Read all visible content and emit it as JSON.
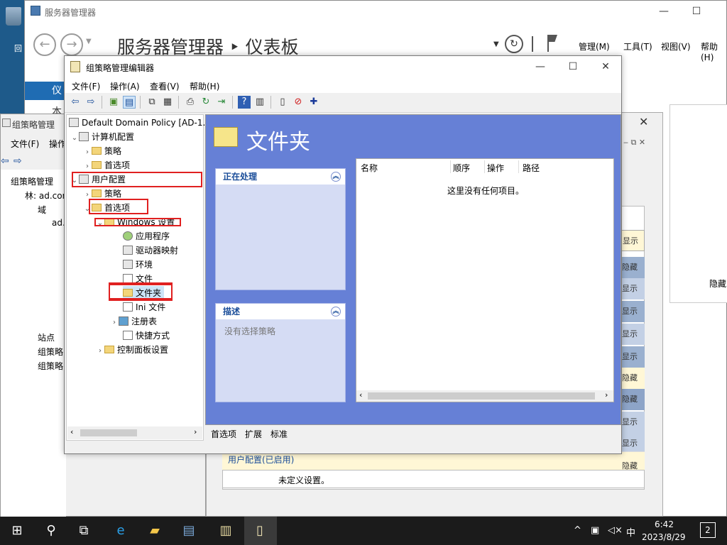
{
  "desktop": {
    "icon_label": "回"
  },
  "server_manager": {
    "title": "服务器管理器",
    "breadcrumb": "服务器管理器 ‣ 仪表板",
    "menus": [
      "管理(M)",
      "工具(T)",
      "视图(V)",
      "帮助(H)"
    ],
    "sidebar_selected": "仪",
    "sidebar_item": "本",
    "hide_label": "隐藏"
  },
  "gpm": {
    "title": "组策略管理",
    "menus": [
      "文件(F)",
      "操作"
    ],
    "tree": [
      {
        "label": "组策略管理"
      },
      {
        "label": "林: ad.com"
      },
      {
        "label": "域"
      },
      {
        "label": "ad."
      },
      {
        "label": "站点"
      },
      {
        "label": "组策略"
      },
      {
        "label": "组策略"
      }
    ],
    "right_stripes": [
      "显示",
      "隐藏",
      "显示",
      "显示",
      "显示",
      "显示",
      "隐藏",
      "隐藏",
      "显示",
      "显示",
      "隐藏"
    ],
    "user_config_bar": "用户配置(已启用)",
    "undefined_setting": "未定义设置。"
  },
  "gpme": {
    "title": "组策略管理编辑器",
    "menus": [
      "文件(F)",
      "操作(A)",
      "查看(V)",
      "帮助(H)"
    ],
    "tree": {
      "root": "Default Domain Policy [AD-1.",
      "computer_config": "计算机配置",
      "cc_policy": "策略",
      "cc_prefs": "首选项",
      "user_config": "用户配置",
      "uc_policy": "策略",
      "uc_prefs": "首选项",
      "windows_settings": "Windows 设置",
      "applications": "应用程序",
      "drive_maps": "驱动器映射",
      "environment": "环境",
      "files": "文件",
      "folders": "文件夹",
      "ini_files": "Ini 文件",
      "registry": "注册表",
      "shortcuts": "快捷方式",
      "control_panel": "控制面板设置"
    },
    "content_title": "文件夹",
    "task_processing": "正在处理",
    "task_description": "描述",
    "no_policy": "没有选择策略",
    "columns": [
      "名称",
      "顺序",
      "操作",
      "路径"
    ],
    "empty_message": "这里没有任何项目。",
    "tabs": [
      "首选项",
      "扩展",
      "标准"
    ]
  },
  "taskbar": {
    "time": "6:42",
    "date": "2023/8/29",
    "ime": "中",
    "notification_count": "2"
  }
}
